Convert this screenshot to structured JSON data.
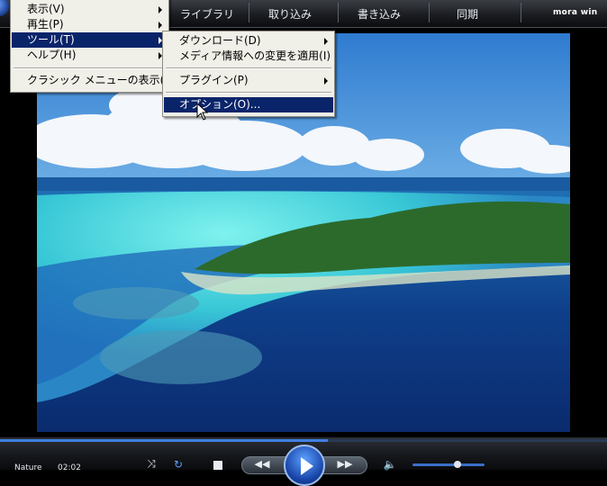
{
  "tabs": [
    "ライブラリ",
    "取り込み",
    "書き込み",
    "同期"
  ],
  "brand": "mora win",
  "main_menu": {
    "items": [
      {
        "label": "表示(V)",
        "submenu": true
      },
      {
        "label": "再生(P)",
        "submenu": true
      },
      {
        "label": "ツール(T)",
        "submenu": true,
        "highlighted": true
      },
      {
        "label": "ヘルプ(H)",
        "submenu": true
      },
      {
        "label": "クラシック メニューの表示(S)",
        "submenu": false
      }
    ]
  },
  "tools_menu": {
    "items": [
      {
        "label": "ダウンロード(D)",
        "submenu": true
      },
      {
        "label": "メディア情報への変更を適用(I)",
        "submenu": false
      },
      {
        "label": "プラグイン(P)",
        "submenu": true
      },
      {
        "label": "オプション(O)...",
        "submenu": false,
        "highlighted": true
      }
    ]
  },
  "status": {
    "track": "Nature",
    "time": "02:02"
  },
  "playback": {
    "seek_progress": 0.54,
    "volume": 0.62
  },
  "colors": {
    "menu_highlight": "#0a246a",
    "menu_bg": "#f0efe8",
    "accent": "#3f7fe0"
  }
}
